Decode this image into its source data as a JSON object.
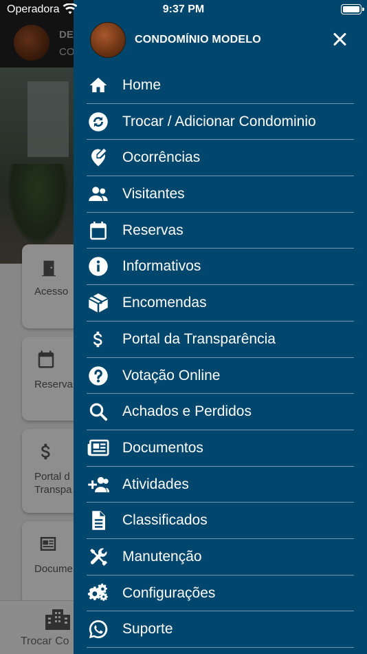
{
  "status_bar": {
    "carrier": "Operadora",
    "time": "9:37 PM"
  },
  "background": {
    "header_line1": "DE",
    "header_line2": "CO",
    "cards": [
      {
        "icon": "door-icon",
        "label": "Acesso"
      },
      {
        "icon": "calendar-icon",
        "label": "Reserva"
      },
      {
        "icon": "dollar-icon",
        "label": "Portal d\nTranspa"
      },
      {
        "icon": "newspaper-icon",
        "label": "Docume"
      }
    ],
    "bottom_tab_label": "Trocar Co"
  },
  "drawer": {
    "title": "CONDOMÍNIO MODELO",
    "items": [
      {
        "icon": "home-icon",
        "label": "Home"
      },
      {
        "icon": "swap-icon",
        "label": "Trocar / Adicionar Condominio"
      },
      {
        "icon": "report-icon",
        "label": "Ocorrências"
      },
      {
        "icon": "visitors-icon",
        "label": "Visitantes"
      },
      {
        "icon": "calendar-icon",
        "label": "Reservas"
      },
      {
        "icon": "info-icon",
        "label": "Informativos"
      },
      {
        "icon": "package-icon",
        "label": "Encomendas"
      },
      {
        "icon": "dollar-icon",
        "label": "Portal da Transparência"
      },
      {
        "icon": "question-icon",
        "label": "Votação Online"
      },
      {
        "icon": "search-icon",
        "label": "Achados e Perdidos"
      },
      {
        "icon": "newspaper-icon",
        "label": "Documentos"
      },
      {
        "icon": "add-user-icon",
        "label": "Atividades"
      },
      {
        "icon": "document-icon",
        "label": "Classificados"
      },
      {
        "icon": "tools-icon",
        "label": "Manutenção"
      },
      {
        "icon": "gears-icon",
        "label": "Configurações"
      },
      {
        "icon": "whatsapp-icon",
        "label": "Suporte"
      }
    ]
  },
  "colors": {
    "drawer_bg": "#00466d",
    "text": "#ffffff"
  }
}
